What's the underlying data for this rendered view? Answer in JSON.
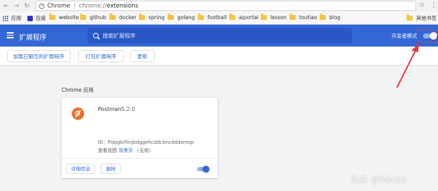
{
  "browser": {
    "omnibox_label": "Chrome",
    "url_scheme": "chrome://",
    "url_path": "extensions",
    "bookmarks": [
      {
        "label": "应用",
        "icon": "apps-icon"
      },
      {
        "label": "百度",
        "icon": "baidu-icon"
      },
      {
        "label": "website",
        "icon": "folder-icon"
      },
      {
        "label": "github",
        "icon": "folder-icon"
      },
      {
        "label": "docker",
        "icon": "folder-icon"
      },
      {
        "label": "spring",
        "icon": "folder-icon"
      },
      {
        "label": "golang",
        "icon": "folder-icon"
      },
      {
        "label": "football",
        "icon": "folder-icon"
      },
      {
        "label": "aiportal",
        "icon": "folder-icon"
      },
      {
        "label": "lesson",
        "icon": "folder-icon"
      },
      {
        "label": "toutiao",
        "icon": "folder-icon"
      },
      {
        "label": "blog",
        "icon": "folder-icon"
      },
      {
        "label": "其他书签",
        "icon": "folder-icon"
      }
    ]
  },
  "header": {
    "title": "扩展程序",
    "search_placeholder": "搜索扩展程序",
    "dev_mode_label": "开发者模式",
    "dev_mode_on": true,
    "accent_color": "#3367d6"
  },
  "toolbar": {
    "load_unpacked": "加载已解压的扩展程序",
    "pack": "打包扩展程序",
    "update": "更新"
  },
  "section": {
    "title": "Chrome 应用"
  },
  "extension": {
    "name": "Postman",
    "version": "5.2.0",
    "id_text": "ID：fhbjgbiflinjbdggehcddcbncdddomop",
    "views_prefix": "查看视图",
    "views_link": "背景页",
    "views_suffix": "（无效）",
    "details_button": "详细信息",
    "remove_button": "删除",
    "enabled": true,
    "icon": "postman-icon"
  },
  "annotation": {
    "color": "#e53935"
  },
  "watermark": "头条 @Woola"
}
